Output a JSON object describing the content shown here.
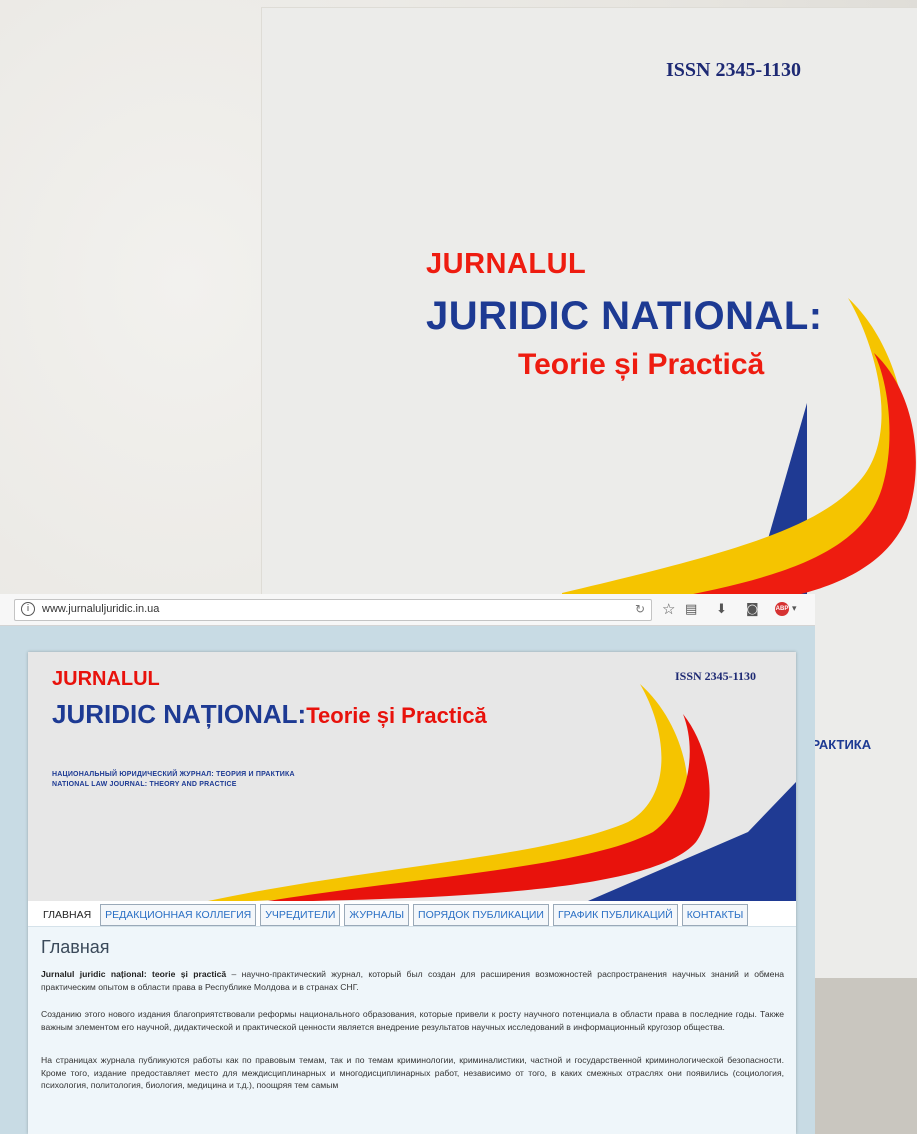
{
  "slide": {
    "cover": {
      "issn": "ISSN 2345-1130",
      "title_line1": "JURNALUL",
      "title_line2": "JURIDIC NATIONAL:",
      "title_line3": "Teorie și Practică",
      "side_text": "ПРАКТИКА"
    }
  },
  "browser": {
    "url": "www.jurnaluljuridic.in.ua",
    "toolbar_icons": [
      "info-icon",
      "reload-icon",
      "star-icon",
      "reading-list-icon",
      "download-icon",
      "pocket-icon",
      "adblock-icon"
    ],
    "abp_label": "ABP"
  },
  "site": {
    "header": {
      "jurnalul": "JURNALUL",
      "title_main": "JURIDIC NAȚIONAL:",
      "title_accent": "Teorie și Practică",
      "issn": "ISSN 2345-1130",
      "subtitle_ru": "НАЦИОНАЛЬНЫЙ ЮРИДИЧЕСКИЙ ЖУРНАЛ: ТЕОРИЯ И ПРАКТИКА",
      "subtitle_en": "NATIONAL LAW JOURNAL: THEORY AND PRACTICE"
    },
    "tabs": [
      {
        "label": "ГЛАВНАЯ",
        "active": true
      },
      {
        "label": "РЕДАКЦИОННАЯ КОЛЛЕГИЯ",
        "active": false
      },
      {
        "label": "УЧРЕДИТЕЛИ",
        "active": false
      },
      {
        "label": "ЖУРНАЛЫ",
        "active": false
      },
      {
        "label": "ПОРЯДОК ПУБЛИКАЦИИ",
        "active": false
      },
      {
        "label": "ГРАФИК ПУБЛИКАЦИЙ",
        "active": false
      },
      {
        "label": "КОНТАКТЫ",
        "active": false
      }
    ],
    "content": {
      "heading": "Главная",
      "p1_bold": "Jurnalul juridic național: teorie și practică",
      "p1_rest": " – научно-практический журнал, который был создан для расширения возможностей распространения научных знаний и обмена практическим опытом в области права в Республике Молдова и в странах СНГ.",
      "p2": "Созданию этого нового издания благоприятствовали реформы национального образования, которые привели к росту научного потенциала в области права в последние годы. Также важным элементом его научной, дидактической и практической ценности является внедрение результатов научных исследований в информационный кругозор общества.",
      "p3": "На страницах журнала публикуются работы как по правовым темам, так и по темам криминологии, криминалистики, частной и государственной криминологической безопасности. Кроме того, издание предоставляет место для междисциплинарных и многодисциплинарных работ, независимо от того, в каких смежных отраслях они появились (социология, психология, политология, биология, медицина и т.д.), поощряя тем самым"
    }
  },
  "colors": {
    "navy": "#1d3a93",
    "red": "#e8120c",
    "yellow": "#f5c400",
    "link": "#2a6fc4",
    "browser_bg": "#c8dbe4"
  }
}
